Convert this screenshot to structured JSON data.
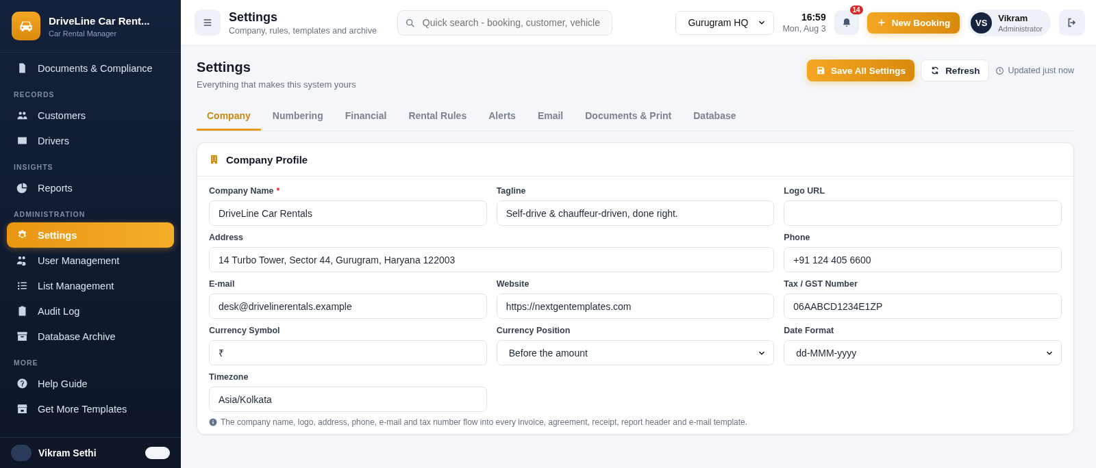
{
  "sidebar": {
    "brand": {
      "name": "DriveLine Car Rent...",
      "subtitle": "Car Rental Manager"
    },
    "sections": [
      {
        "items": [
          {
            "label": "Documents & Compliance",
            "selected": false
          }
        ]
      },
      {
        "title": "RECORDS",
        "items": [
          {
            "label": "Customers",
            "selected": false
          },
          {
            "label": "Drivers",
            "selected": false
          }
        ]
      },
      {
        "title": "INSIGHTS",
        "items": [
          {
            "label": "Reports",
            "selected": false
          }
        ]
      },
      {
        "title": "ADMINISTRATION",
        "items": [
          {
            "label": "Settings",
            "selected": true
          },
          {
            "label": "User Management",
            "selected": false
          },
          {
            "label": "List Management",
            "selected": false
          },
          {
            "label": "Audit Log",
            "selected": false
          },
          {
            "label": "Database Archive",
            "selected": false
          }
        ]
      },
      {
        "title": "MORE",
        "items": [
          {
            "label": "Help Guide",
            "selected": false
          },
          {
            "label": "Get More Templates",
            "selected": false
          }
        ]
      }
    ],
    "user": {
      "name": "Vikram Sethi"
    }
  },
  "header": {
    "title": "Settings",
    "subtitle": "Company, rules, templates and archive",
    "search": {
      "placeholder": "Quick search - booking, customer, vehicle"
    },
    "branch": "Gurugram HQ",
    "time": "16:59",
    "date": "Mon, Aug 3",
    "notifications": "14",
    "new_booking": "New Booking",
    "user": {
      "initials": "VS",
      "name": "Vikram",
      "role": "Administrator"
    }
  },
  "page": {
    "title": "Settings",
    "subtitle": "Everything that makes this system yours",
    "save": "Save All Settings",
    "refresh": "Refresh",
    "updated": "Updated just now"
  },
  "tabs": [
    {
      "label": "Company",
      "selected": true
    },
    {
      "label": "Numbering",
      "selected": false
    },
    {
      "label": "Financial",
      "selected": false
    },
    {
      "label": "Rental Rules",
      "selected": false
    },
    {
      "label": "Alerts",
      "selected": false
    },
    {
      "label": "Email",
      "selected": false
    },
    {
      "label": "Documents & Print",
      "selected": false
    },
    {
      "label": "Database",
      "selected": false
    }
  ],
  "card": {
    "title": "Company Profile",
    "required_mark": "*",
    "fields": [
      {
        "label": "Company Name",
        "required": true,
        "kind": "text",
        "value": "DriveLine Car Rentals"
      },
      {
        "label": "Tagline",
        "required": false,
        "kind": "text",
        "value": "Self-drive & chauffeur-driven, done right."
      },
      {
        "label": "Logo URL",
        "required": false,
        "kind": "text"
      },
      {
        "label": "Address",
        "required": false,
        "kind": "text",
        "value": "14 Turbo Tower, Sector 44, Gurugram, Haryana 122003"
      },
      {
        "label": "Phone",
        "required": false,
        "kind": "text",
        "value": "+91 124 405 6600"
      },
      {
        "label": "E-mail",
        "required": false,
        "kind": "text",
        "value": "desk@drivelinerentals.example"
      },
      {
        "label": "Website",
        "required": false,
        "kind": "text",
        "value": "https://nextgentemplates.com"
      },
      {
        "label": "Tax / GST Number",
        "required": false,
        "kind": "text",
        "value": "06AABCD1234E1ZP"
      },
      {
        "label": "Currency Symbol",
        "required": false,
        "kind": "text",
        "value": "₹"
      },
      {
        "label": "Currency Position",
        "required": false,
        "kind": "select",
        "value": "Before the amount"
      },
      {
        "label": "Date Format",
        "required": false,
        "kind": "select",
        "value": "dd-MMM-yyyy"
      },
      {
        "label": "Timezone",
        "required": false,
        "kind": "text",
        "value": "Asia/Kolkata"
      }
    ],
    "note": "The company name, logo, address, phone, e-mail and tax number flow into every invoice, agreement, receipt, report header and e-mail template."
  }
}
